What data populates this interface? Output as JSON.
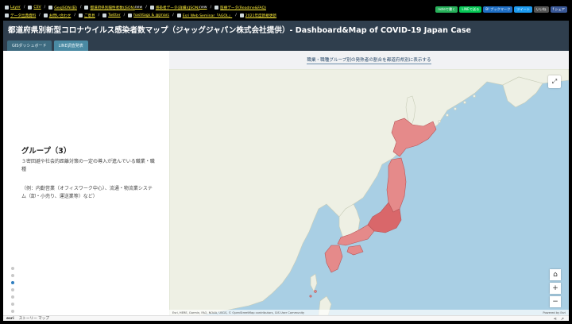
{
  "linkbar": {
    "row1": [
      {
        "label": "Layer",
        "new": false
      },
      {
        "label": "CSV",
        "new": false
      },
      {
        "label": "GeoJSON(旧)",
        "new": false
      },
      {
        "label": "都道府県別陽性者数(JSON)",
        "new": true
      },
      {
        "label": "感染者データ(詳細)(JSON)",
        "new": true
      },
      {
        "label": "医療データ(Readme&FAQ)",
        "new": false
      }
    ],
    "row2": [
      {
        "label": "データ出典資料",
        "new": false
      },
      {
        "label": "お問い合わせ",
        "new": false
      },
      {
        "label": "ご意見",
        "new": false
      },
      {
        "label": "Twitter",
        "new": false
      },
      {
        "label": "hashtags & @jmarc",
        "new": false
      },
      {
        "label": "Esri Web Seminar「AGOL」",
        "new": false
      },
      {
        "label": "2021年度新規更新",
        "new": false
      }
    ],
    "share": [
      {
        "label": "noteで書く",
        "color": "#27b05a"
      },
      {
        "label": "LINEで送る",
        "color": "#06c755"
      },
      {
        "label": "B! ブックマーク",
        "color": "#1f6fc5"
      },
      {
        "label": "ツイート",
        "color": "#1d9bf0"
      },
      {
        "label": "いいね",
        "color": "#555555"
      },
      {
        "label": "f シェア",
        "color": "#3b5998"
      }
    ]
  },
  "header": {
    "title": "都道府県別新型コロナウイルス感染者数マップ（ジャッグジャパン株式会社提供）- Dashboard&Map of COVID-19 Japan Case"
  },
  "tabs": [
    {
      "label": "GISダッシュボード",
      "active": false
    },
    {
      "label": "LINE調査発表",
      "active": true
    }
  ],
  "map_subtitle": "職業・職種グループ別の発熱者の割合を都道府県別に表示する",
  "panel": {
    "title": "グループ（3）",
    "description": "３密回避や社会的距離対策の一定の導入が進んでいる職業・職種",
    "example": "（例：内勤営業（オフィスワーク中心）、流通・物流業システム（卸・小売り、運送業等）など）",
    "dot_count": 7,
    "active_dot": 2
  },
  "map": {
    "attribution": "Esri, HERE, Garmin, FAO, NOAA, USGS, © OpenStreetMap contributors, GIS User Community",
    "powered_by": "Powered by Esri",
    "zoom_in": "+",
    "zoom_out": "−",
    "home_icon": "home-icon",
    "expand_icon": "expand-icon",
    "colors": {
      "sea": "#a9cfe4",
      "land": "#eef0e4",
      "japan": "#e58a8a",
      "japan_dark": "#d9676a"
    }
  },
  "footer": {
    "logo": "esri",
    "label": "ストーリー マップ"
  }
}
